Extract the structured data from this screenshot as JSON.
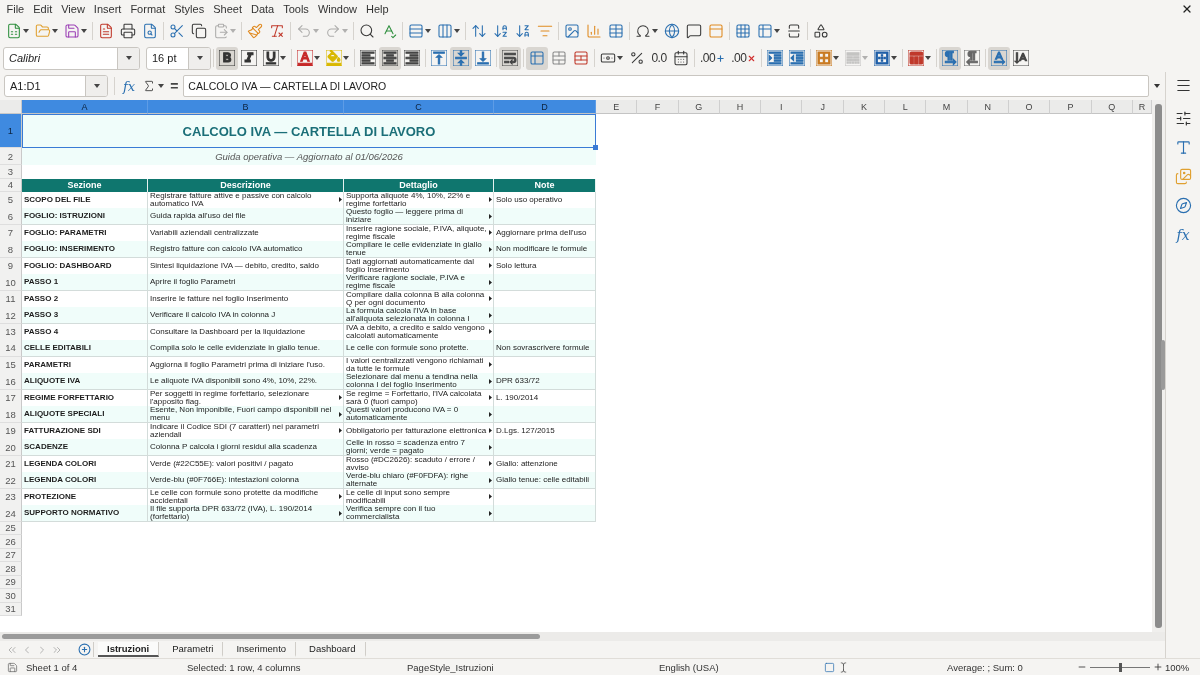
{
  "menu_bar": [
    "File",
    "Edit",
    "View",
    "Insert",
    "Format",
    "Styles",
    "Sheet",
    "Data",
    "Tools",
    "Window",
    "Help"
  ],
  "standard_toolbar": [
    [
      {
        "kind": "new",
        "menu": true,
        "disabled": false
      },
      {
        "kind": "open",
        "menu": true,
        "disabled": false
      },
      {
        "kind": "save",
        "menu": true,
        "disabled": false
      }
    ],
    [
      {
        "kind": "pdf",
        "menu": false,
        "disabled": false
      },
      {
        "kind": "print",
        "menu": false,
        "disabled": false
      },
      {
        "kind": "preview",
        "menu": false,
        "disabled": false
      }
    ],
    [
      {
        "kind": "cut",
        "menu": false,
        "disabled": false
      },
      {
        "kind": "copy",
        "menu": false,
        "disabled": false
      },
      {
        "kind": "paste",
        "menu": true,
        "disabled": true
      }
    ],
    [
      {
        "kind": "clone",
        "menu": false,
        "disabled": false
      },
      {
        "kind": "clear",
        "menu": false,
        "disabled": false
      }
    ],
    [
      {
        "kind": "undo",
        "menu": true,
        "disabled": true
      },
      {
        "kind": "redo",
        "menu": true,
        "disabled": true
      }
    ],
    [
      {
        "kind": "find",
        "menu": false,
        "disabled": false
      },
      {
        "kind": "spelling",
        "menu": false,
        "disabled": false
      }
    ],
    [
      {
        "kind": "rows",
        "menu": true,
        "disabled": false
      },
      {
        "kind": "columns",
        "menu": true,
        "disabled": false
      }
    ],
    [
      {
        "kind": "sort",
        "menu": false,
        "disabled": false
      },
      {
        "kind": "ascending",
        "menu": false,
        "disabled": false
      },
      {
        "kind": "descending",
        "menu": false,
        "disabled": false
      },
      {
        "kind": "autofilter",
        "menu": false,
        "disabled": false
      }
    ],
    [
      {
        "kind": "image",
        "menu": false,
        "disabled": false
      },
      {
        "kind": "chart",
        "menu": false,
        "disabled": false
      },
      {
        "kind": "pivot",
        "menu": false,
        "disabled": false
      }
    ],
    [
      {
        "kind": "special",
        "menu": true,
        "disabled": false
      },
      {
        "kind": "hyperlink",
        "menu": false,
        "disabled": false
      },
      {
        "kind": "comment",
        "menu": false,
        "disabled": false
      },
      {
        "kind": "headers",
        "menu": false,
        "disabled": false
      }
    ],
    [
      {
        "kind": "printarea",
        "menu": false,
        "disabled": false
      },
      {
        "kind": "freeze",
        "menu": true,
        "disabled": false
      },
      {
        "kind": "split",
        "menu": false,
        "disabled": false
      }
    ],
    [
      {
        "kind": "draw",
        "menu": false,
        "disabled": false
      }
    ]
  ],
  "format_toolbar": {
    "font_name": "Calibri",
    "font_size": "16 pt",
    "groups": [
      [
        {
          "kind": "bold",
          "pressed": true,
          "menu": false,
          "disabled": false
        },
        {
          "kind": "italic",
          "pressed": false,
          "menu": false,
          "disabled": false
        },
        {
          "kind": "underline",
          "pressed": false,
          "menu": true,
          "disabled": false
        }
      ],
      [
        {
          "kind": "fontcolor",
          "pressed": false,
          "menu": true,
          "disabled": false
        },
        {
          "kind": "highlight",
          "pressed": false,
          "menu": true,
          "disabled": false
        }
      ],
      [
        {
          "kind": "left",
          "pressed": false,
          "menu": false,
          "disabled": false
        },
        {
          "kind": "center",
          "pressed": true,
          "menu": false,
          "disabled": false
        },
        {
          "kind": "right",
          "pressed": false,
          "menu": false,
          "disabled": false
        }
      ],
      [
        {
          "kind": "top",
          "pressed": false,
          "menu": false,
          "disabled": false
        },
        {
          "kind": "middle",
          "pressed": true,
          "menu": false,
          "disabled": false
        },
        {
          "kind": "bottom",
          "pressed": false,
          "menu": false,
          "disabled": false
        }
      ],
      [
        {
          "kind": "wrap",
          "pressed": true,
          "menu": false,
          "disabled": false
        }
      ],
      [
        {
          "kind": "mergecenter",
          "pressed": true,
          "menu": false,
          "disabled": false
        },
        {
          "kind": "merge",
          "pressed": false,
          "menu": false,
          "disabled": false
        },
        {
          "kind": "unmerge",
          "pressed": false,
          "menu": false,
          "disabled": false
        }
      ],
      [
        {
          "kind": "currency",
          "pressed": false,
          "menu": true,
          "disabled": false
        },
        {
          "kind": "percent",
          "pressed": false,
          "menu": false,
          "disabled": false
        },
        {
          "kind": "number",
          "glyph": "0.0",
          "pressed": false,
          "menu": false,
          "disabled": false
        },
        {
          "kind": "date",
          "pressed": false,
          "menu": false,
          "disabled": false
        }
      ],
      [
        {
          "kind": "adddecimal",
          "glyph": ".00",
          "pressed": false,
          "menu": false,
          "disabled": false
        },
        {
          "kind": "deldecimal",
          "glyph": ".00",
          "pressed": false,
          "menu": false,
          "disabled": false
        }
      ],
      [
        {
          "kind": "indent",
          "pressed": false,
          "menu": false,
          "disabled": false
        },
        {
          "kind": "outdent",
          "pressed": false,
          "menu": false,
          "disabled": false
        }
      ],
      [
        {
          "kind": "borders",
          "pressed": false,
          "menu": true,
          "disabled": false
        },
        {
          "kind": "borderstyle",
          "pressed": false,
          "menu": true,
          "disabled": true
        },
        {
          "kind": "bordercolor",
          "pressed": false,
          "menu": true,
          "disabled": false
        }
      ],
      [
        {
          "kind": "conditional",
          "pressed": false,
          "menu": true,
          "disabled": false
        }
      ],
      [
        {
          "kind": "ltr",
          "pressed": true,
          "menu": false,
          "disabled": false
        },
        {
          "kind": "rtl",
          "pressed": false,
          "menu": false,
          "disabled": false
        }
      ],
      [
        {
          "kind": "horizontal",
          "pressed": true,
          "menu": false,
          "disabled": false
        },
        {
          "kind": "vertical",
          "pressed": false,
          "menu": false,
          "disabled": false
        }
      ]
    ]
  },
  "formula_bar": {
    "name_box": "A1:D1",
    "function_glyph": "fx",
    "equals_glyph": "=",
    "content": "CALCOLO IVA — CARTELLA DI LAVORO"
  },
  "sidebar": [
    {
      "kind": "menu"
    },
    {
      "kind": "properties"
    },
    {
      "kind": "styles"
    },
    {
      "kind": "gallery"
    },
    {
      "kind": "navigator"
    },
    {
      "kind": "functions",
      "glyph": "fx"
    }
  ],
  "sheet": {
    "columns": [
      {
        "label": "A",
        "selected": true
      },
      {
        "label": "B",
        "selected": true
      },
      {
        "label": "C",
        "selected": true
      },
      {
        "label": "D",
        "selected": true
      },
      {
        "label": "E",
        "selected": false
      },
      {
        "label": "F",
        "selected": false
      },
      {
        "label": "G",
        "selected": false
      },
      {
        "label": "H",
        "selected": false
      },
      {
        "label": "I",
        "selected": false
      },
      {
        "label": "J",
        "selected": false
      },
      {
        "label": "K",
        "selected": false
      },
      {
        "label": "L",
        "selected": false
      },
      {
        "label": "M",
        "selected": false
      },
      {
        "label": "N",
        "selected": false
      },
      {
        "label": "O",
        "selected": false
      },
      {
        "label": "P",
        "selected": false
      },
      {
        "label": "Q",
        "selected": false
      },
      {
        "label": "R",
        "selected": false
      }
    ],
    "rows": [
      {
        "number": "1",
        "selected": true,
        "kind": "title",
        "text": "CALCOLO IVA — CARTELLA DI LAVORO"
      },
      {
        "number": "2",
        "selected": false,
        "kind": "subtitle",
        "text": "Guida operativa — Aggiornato al 01/06/2026"
      },
      {
        "number": "3",
        "selected": false,
        "kind": "blank"
      },
      {
        "number": "4",
        "selected": false,
        "kind": "header",
        "cells": [
          "Sezione",
          "Descrizione",
          "Dettaglio",
          "Note"
        ]
      },
      {
        "number": "5",
        "selected": false,
        "kind": "data",
        "section": "SCOPO DEL FILE",
        "description": {
          "text": "Registrare fatture attive e passive con calcolo automatico IVA",
          "overflow": true
        },
        "detail": {
          "text": "Supporta aliquote 4%, 10%, 22% e regime forfettario",
          "overflow": true
        },
        "note": "Solo uso operativo"
      },
      {
        "number": "6",
        "selected": false,
        "kind": "data",
        "section": "FOGLIO: ISTRUZIONI",
        "description": {
          "text": "Guida rapida all'uso del file",
          "overflow": false
        },
        "detail": {
          "text": "Questo foglio — leggere prima di iniziare",
          "overflow": true
        }
      },
      {
        "number": "7",
        "selected": false,
        "kind": "data",
        "section": "FOGLIO: PARAMETRI",
        "description": {
          "text": "Variabili aziendali centralizzate",
          "overflow": false
        },
        "detail": {
          "text": "Inserire ragione sociale, P.IVA, aliquote, regime fiscale",
          "overflow": true
        },
        "note": "Aggiornare prima dell'uso"
      },
      {
        "number": "8",
        "selected": false,
        "kind": "data",
        "section": "FOGLIO: INSERIMENTO",
        "description": {
          "text": "Registro fatture con calcolo IVA automatico",
          "overflow": false
        },
        "detail": {
          "text": "Compilare le celle evidenziate in giallo tenue",
          "overflow": true
        },
        "note": "Non modificare le formule"
      },
      {
        "number": "9",
        "selected": false,
        "kind": "data",
        "section": "FOGLIO: DASHBOARD",
        "description": {
          "text": "Sintesi liquidazione IVA — debito, credito, saldo",
          "overflow": false
        },
        "detail": {
          "text": "Dati aggiornati automaticamente dal foglio Inserimento",
          "overflow": true
        },
        "note": "Solo lettura"
      },
      {
        "number": "10",
        "selected": false,
        "kind": "data",
        "section": "PASSO 1",
        "description": {
          "text": "Aprire il foglio Parametri",
          "overflow": false
        },
        "detail": {
          "text": "Verificare ragione sociale, P.IVA e regime fiscale",
          "overflow": true
        }
      },
      {
        "number": "11",
        "selected": false,
        "kind": "data",
        "section": "PASSO 2",
        "description": {
          "text": "Inserire le fatture nel foglio Inserimento",
          "overflow": false
        },
        "detail": {
          "text": "Compilare dalla colonna B alla colonna Q per ogni documento",
          "overflow": true
        }
      },
      {
        "number": "12",
        "selected": false,
        "kind": "data",
        "section": "PASSO 3",
        "description": {
          "text": "Verificare il calcolo IVA in colonna J",
          "overflow": false
        },
        "detail": {
          "text": "La formula calcola l'IVA in base all'aliquota selezionata in colonna I",
          "overflow": true
        }
      },
      {
        "number": "13",
        "selected": false,
        "kind": "data",
        "section": "PASSO 4",
        "description": {
          "text": "Consultare la Dashboard per la liquidazione",
          "overflow": false
        },
        "detail": {
          "text": "IVA a debito, a credito e saldo vengono calcolati automaticamente",
          "overflow": true
        }
      },
      {
        "number": "14",
        "selected": false,
        "kind": "data",
        "section": "CELLE EDITABILI",
        "description": {
          "text": "Compila solo le celle evidenziate in giallo tenue.",
          "overflow": false
        },
        "detail": {
          "text": "Le celle con formule sono protette.",
          "overflow": false
        },
        "note": "Non sovrascrivere formule"
      },
      {
        "number": "15",
        "selected": false,
        "kind": "data",
        "section": "PARAMETRI",
        "description": {
          "text": "Aggiorna il foglio Parametri prima di iniziare l'uso.",
          "overflow": false
        },
        "detail": {
          "text": "I valori centralizzati vengono richiamati da tutte le formule",
          "overflow": true
        }
      },
      {
        "number": "16",
        "selected": false,
        "kind": "data",
        "section": "ALIQUOTE IVA",
        "description": {
          "text": "Le aliquote IVA disponibili sono 4%, 10%, 22%.",
          "overflow": false
        },
        "detail": {
          "text": "Selezionare dal menu a tendina nella colonna I del foglio Inserimento",
          "overflow": true
        },
        "note": "DPR 633/72"
      },
      {
        "number": "17",
        "selected": false,
        "kind": "data",
        "section": "REGIME FORFETTARIO",
        "description": {
          "text": "Per soggetti in regime forfettario, selezionare l'apposito flag.",
          "overflow": true
        },
        "detail": {
          "text": "Se regime = Forfettario, l'IVA calcolata sarà 0 (fuori campo)",
          "overflow": true
        },
        "note": "L. 190/2014"
      },
      {
        "number": "18",
        "selected": false,
        "kind": "data",
        "section": "ALIQUOTE SPECIALI",
        "description": {
          "text": "Esente, Non imponibile, Fuori campo disponibili nel menu",
          "overflow": true
        },
        "detail": {
          "text": "Questi valori producono IVA = 0 automaticamente",
          "overflow": true
        }
      },
      {
        "number": "19",
        "selected": false,
        "kind": "data",
        "section": "FATTURAZIONE SDI",
        "description": {
          "text": "Indicare il Codice SDI (7 caratteri) nei parametri aziendali",
          "overflow": true
        },
        "detail": {
          "text": "Obbligatorio per fatturazione elettronica",
          "overflow": true
        },
        "note": "D.Lgs. 127/2015"
      },
      {
        "number": "20",
        "selected": false,
        "kind": "data",
        "section": "SCADENZE",
        "description": {
          "text": "Colonna P calcola i giorni residui alla scadenza",
          "overflow": false
        },
        "detail": {
          "text": "Celle in rosso = scadenza entro 7 giorni; verde = pagato",
          "overflow": true
        }
      },
      {
        "number": "21",
        "selected": false,
        "kind": "data",
        "section": "LEGENDA COLORI",
        "description": {
          "text": "Verde (#22C55E): valori positivi / pagato",
          "overflow": false
        },
        "detail": {
          "text": "Rosso (#DC2626): scaduto / errore / avviso",
          "overflow": true
        },
        "note": "Giallo: attenzione"
      },
      {
        "number": "22",
        "selected": false,
        "kind": "data",
        "section": "LEGENDA COLORI",
        "description": {
          "text": "Verde-blu (#0F766E): intestazioni colonna",
          "overflow": false
        },
        "detail": {
          "text": "Verde-blu chiaro (#F0FDFA): righe alternate",
          "overflow": true
        },
        "note": "Giallo tenue: celle editabili"
      },
      {
        "number": "23",
        "selected": false,
        "kind": "data",
        "section": "PROTEZIONE",
        "description": {
          "text": "Le celle con formule sono protette da modifiche accidentali",
          "overflow": true
        },
        "detail": {
          "text": "Le celle di input sono sempre modificabili",
          "overflow": true
        }
      },
      {
        "number": "24",
        "selected": false,
        "kind": "data",
        "section": "SUPPORTO NORMATIVO",
        "description": {
          "text": "Il file supporta DPR 633/72 (IVA), L. 190/2014 (forfettario)",
          "overflow": true
        },
        "detail": {
          "text": "Verifica sempre con il tuo commercialista",
          "overflow": true
        }
      },
      {
        "number": "25",
        "selected": false,
        "kind": "blank"
      },
      {
        "number": "26",
        "selected": false,
        "kind": "blank"
      },
      {
        "number": "27",
        "selected": false,
        "kind": "blank"
      },
      {
        "number": "28",
        "selected": false,
        "kind": "blank"
      },
      {
        "number": "29",
        "selected": false,
        "kind": "blank"
      },
      {
        "number": "30",
        "selected": false,
        "kind": "blank"
      },
      {
        "number": "31",
        "selected": false,
        "kind": "blank"
      }
    ]
  },
  "sheet_navigation": [
    {
      "kind": "first",
      "disabled": true
    },
    {
      "kind": "previous",
      "disabled": true
    },
    {
      "kind": "next",
      "disabled": true
    },
    {
      "kind": "last",
      "disabled": true
    }
  ],
  "sheet_tabs": [
    {
      "label": "Istruzioni",
      "selected": true
    },
    {
      "label": "Parametri",
      "selected": false
    },
    {
      "label": "Inserimento",
      "selected": false
    },
    {
      "label": "Dashboard",
      "selected": false
    }
  ],
  "status_bar": {
    "sheet": "Sheet 1 of 4",
    "selection": "Selected: 1 row, 4 columns",
    "page_style": "PageStyle_Istruzioni",
    "language": "English (USA)",
    "summary": "Average: ; Sum: 0",
    "zoom": {
      "level": 0.5,
      "reading": "100%"
    }
  }
}
